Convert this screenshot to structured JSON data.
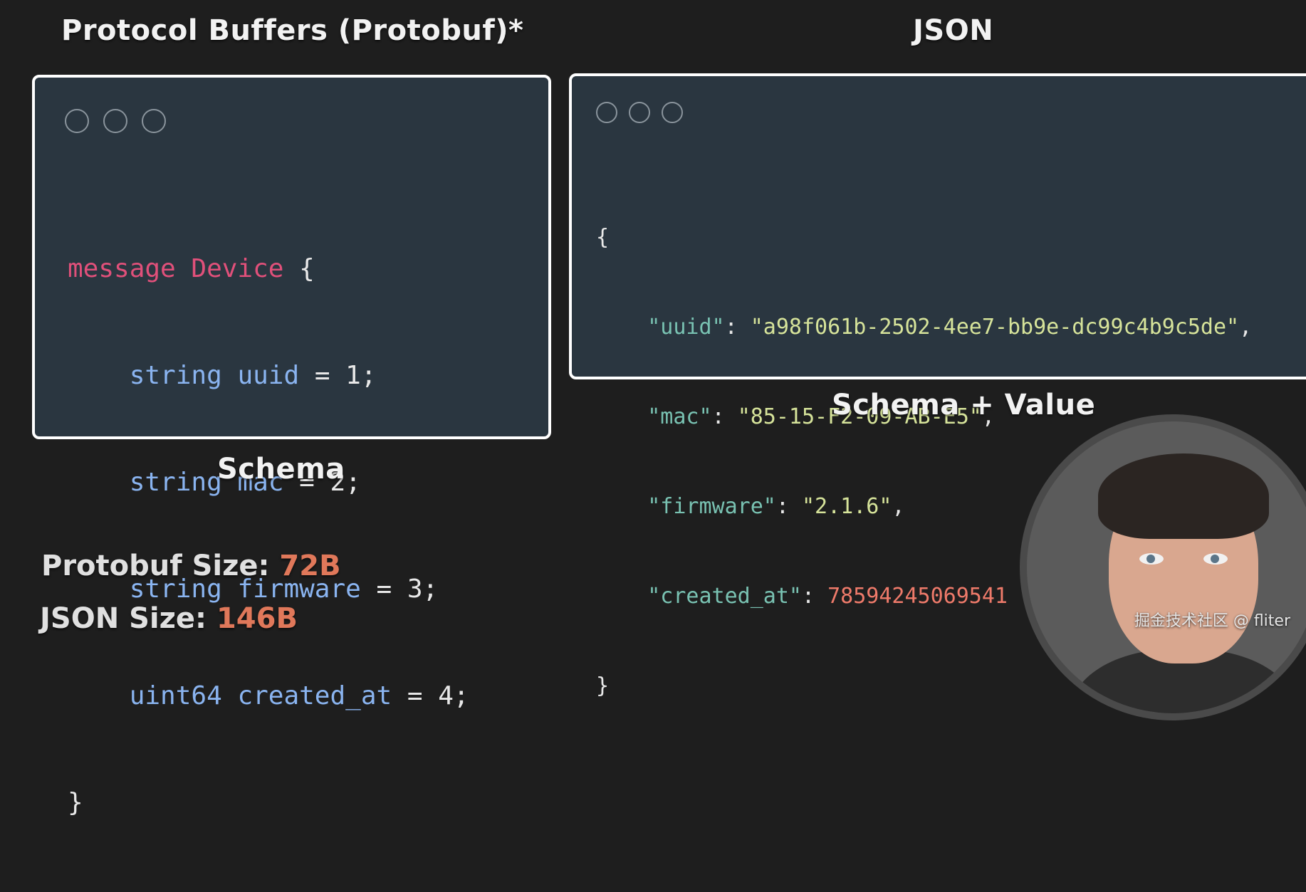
{
  "protobuf_panel": {
    "title": "Protocol Buffers (Protobuf)*",
    "caption": "Schema",
    "code": {
      "line1_kw": "message",
      "line1_name": "Device",
      "line1_brace": " {",
      "fields": [
        {
          "type": "string",
          "name": "uuid",
          "rest": " = 1;"
        },
        {
          "type": "string",
          "name": "mac",
          "rest": " = 2;"
        },
        {
          "type": "string",
          "name": "firmware",
          "rest": " = 3;"
        },
        {
          "type": "uint64",
          "name": "created_at",
          "rest": " = 4;"
        }
      ],
      "close_brace": "}"
    }
  },
  "json_panel": {
    "title": "JSON",
    "caption": "Schema + Value",
    "code": {
      "open_brace": "{",
      "entries": [
        {
          "key": "\"uuid\"",
          "sep": ": ",
          "value": "\"a98f061b-2502-4ee7-bb9e-dc99c4b9c5de\"",
          "trail": ","
        },
        {
          "key": "\"mac\"",
          "sep": ": ",
          "value": "\"85-15-F2-09-AB-E5\"",
          "trail": ","
        },
        {
          "key": "\"firmware\"",
          "sep": ": ",
          "value": "\"2.1.6\"",
          "trail": ","
        },
        {
          "key": "\"created_at\"",
          "sep": ": ",
          "value": "78594245069541",
          "trail": ""
        }
      ],
      "close_brace": "}"
    }
  },
  "sizes": {
    "protobuf_label": "Protobuf Size: ",
    "protobuf_value": "72B",
    "json_label": "JSON Size: ",
    "json_value": "146B"
  },
  "watermark": "掘金技术社区 @ fliter",
  "colors": {
    "background": "#1e1e1e",
    "code_bg": "#2a3640",
    "keyword_pink": "#e0507a",
    "keyword_blue": "#8ab4f0",
    "json_key": "#79c2b2",
    "json_string": "#d6e39a",
    "json_number": "#ee7a6a",
    "size_value": "#e0785a"
  }
}
